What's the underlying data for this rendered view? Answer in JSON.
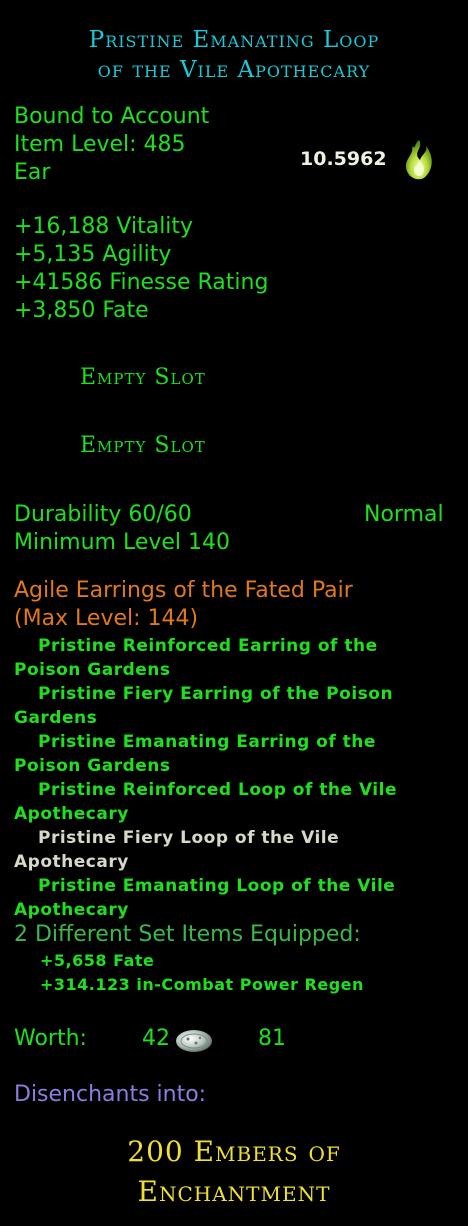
{
  "title": {
    "line1": "Pristine Emanating Loop",
    "line2": "of the Vile Apothecary"
  },
  "binding": "Bound to Account",
  "item_level": "Item Level: 485",
  "slot_type": "Ear",
  "essence_value": "10.5962",
  "stats": [
    "+16,188 Vitality",
    "+5,135 Agility",
    "+41586 Finesse Rating",
    "+3,850 Fate"
  ],
  "essence_slots": [
    "Empty Slot",
    "Empty Slot"
  ],
  "durability": "Durability 60/60",
  "quality": "Normal",
  "min_level": "Minimum Level 140",
  "set": {
    "name": "Agile Earrings of the Fated Pair",
    "max_level": "(Max Level: 144)",
    "items": [
      {
        "line1": "Pristine Reinforced Earring of the",
        "line2": "Poison Gardens",
        "equipped": true
      },
      {
        "line1": "Pristine Fiery Earring of the Poison",
        "line2": "Gardens",
        "equipped": true
      },
      {
        "line1": "Pristine Emanating Earring of the",
        "line2": "Poison Gardens",
        "equipped": true
      },
      {
        "line1": "Pristine Reinforced Loop of the Vile",
        "line2": "Apothecary",
        "equipped": true
      },
      {
        "line1": "Pristine Fiery Loop of the Vile",
        "line2": "Apothecary",
        "equipped": false
      },
      {
        "line1": "Pristine Emanating Loop of the Vile",
        "line2": "Apothecary",
        "equipped": true
      }
    ],
    "equipped_count": "2 Different Set Items Equipped:",
    "bonuses": [
      "+5,658 Fate",
      "+314.123 in-Combat Power Regen"
    ]
  },
  "worth": {
    "label": "Worth:",
    "silver": "42",
    "copper": "81"
  },
  "disenchant": {
    "label": "Disenchants into:",
    "line1": "200 Embers of",
    "line2": "Enchantment"
  },
  "colors": {
    "title": "#19c9d6",
    "stat_green": "#1ee01e",
    "set_orange": "#e0781c",
    "inactive": "#d8d8c8",
    "disenchant_purple": "#8a7ee0",
    "reward_yellow": "#f0e030"
  },
  "icons": [
    "essence-flame-icon",
    "silver-coin-icon"
  ]
}
